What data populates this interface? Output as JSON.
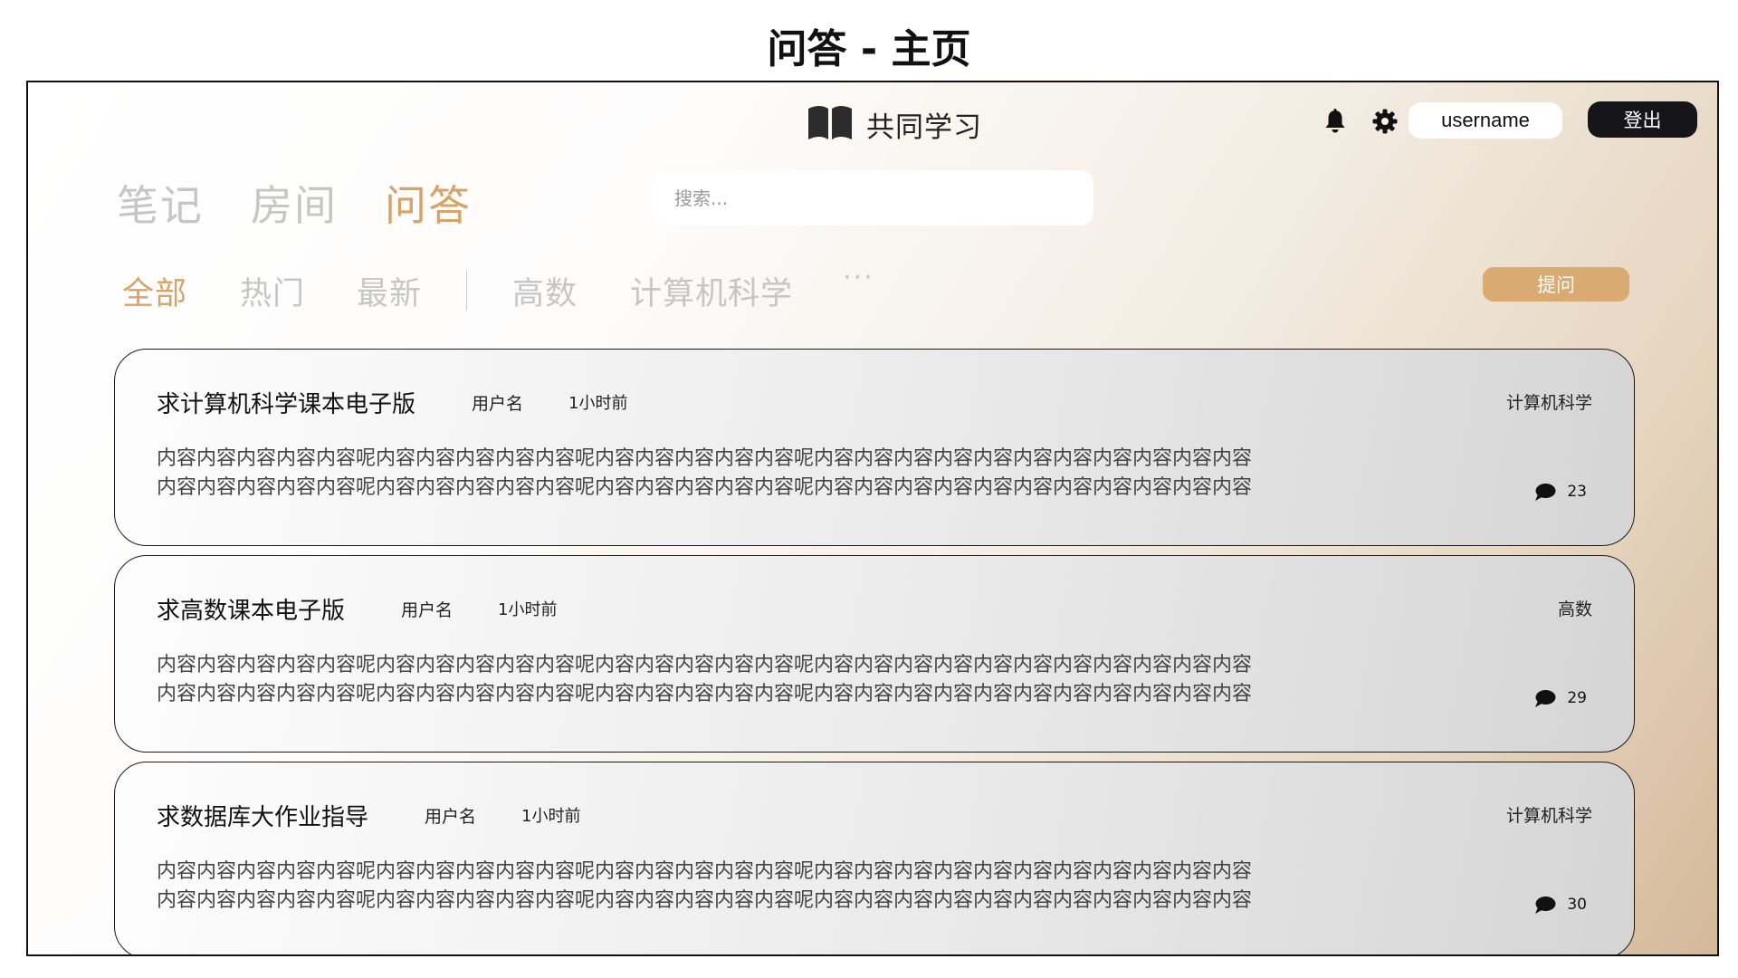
{
  "page_caption": "问答 - 主页",
  "header": {
    "brand": "共同学习",
    "username": "username",
    "logout_label": "登出",
    "icons": [
      "book-icon",
      "bell-icon",
      "gear-icon"
    ]
  },
  "main_tabs": [
    {
      "label": "笔记",
      "active": false
    },
    {
      "label": "房间",
      "active": false
    },
    {
      "label": "问答",
      "active": true
    }
  ],
  "search": {
    "placeholder": "搜索...",
    "value": ""
  },
  "filters": [
    {
      "label": "全部",
      "active": true
    },
    {
      "label": "热门",
      "active": false
    },
    {
      "label": "最新",
      "active": false
    },
    {
      "label": "高数",
      "active": false
    },
    {
      "label": "计算机科学",
      "active": false
    }
  ],
  "more_label": "···",
  "ask_label": "提问",
  "colors": {
    "accent": "#d6a468",
    "button_accent": "#d9aa71",
    "dark": "#16161a",
    "inactive": "#c6c6c6"
  },
  "questions": [
    {
      "title": "求计算机科学课本电子版",
      "user": "用户名",
      "time": "1小时前",
      "tag": "计算机科学",
      "lines": [
        "内容内容内容内容内容呢内容内容内容内容内容呢内容内容内容内容内容呢内容内容内容内容内容内容内容内容内容内容内容",
        "内容内容内容内容内容呢内容内容内容内容内容呢内容内容内容内容内容呢内容内容内容内容内容内容内容内容内容内容内容"
      ],
      "comments": "23"
    },
    {
      "title": "求高数课本电子版",
      "user": "用户名",
      "time": "1小时前",
      "tag": "高数",
      "lines": [
        "内容内容内容内容内容呢内容内容内容内容内容呢内容内容内容内容内容呢内容内容内容内容内容内容内容内容内容内容内容",
        "内容内容内容内容内容呢内容内容内容内容内容呢内容内容内容内容内容呢内容内容内容内容内容内容内容内容内容内容内容"
      ],
      "comments": "29"
    },
    {
      "title": "求数据库大作业指导",
      "user": "用户名",
      "time": "1小时前",
      "tag": "计算机科学",
      "lines": [
        "内容内容内容内容内容呢内容内容内容内容内容呢内容内容内容内容内容呢内容内容内容内容内容内容内容内容内容内容内容",
        "内容内容内容内容内容呢内容内容内容内容内容呢内容内容内容内容内容呢内容内容内容内容内容内容内容内容内容内容内容"
      ],
      "comments": "30"
    }
  ]
}
